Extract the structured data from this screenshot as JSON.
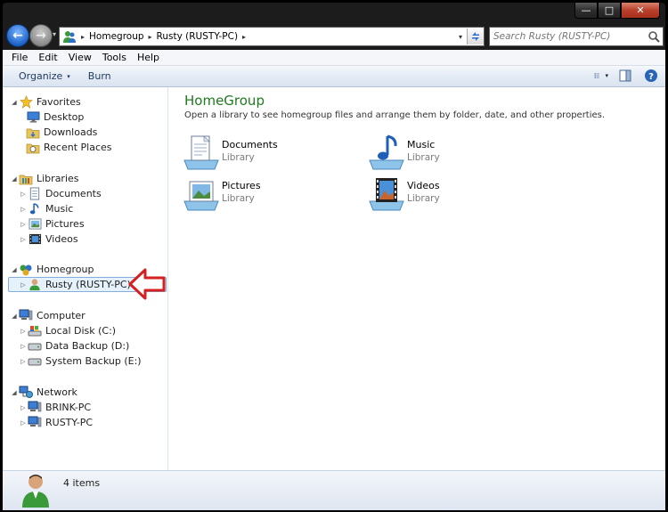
{
  "window": {
    "minimize_glyph": "—",
    "maximize_glyph": "□",
    "close_glyph": "✕"
  },
  "navigation": {
    "back_glyph": "←",
    "forward_glyph": "→",
    "history_dropdown_glyph": "▾"
  },
  "address_bar": {
    "icon": "homegroup-icon",
    "breadcrumb": [
      "Homegroup",
      "Rusty (RUSTY-PC)"
    ],
    "separator_glyph": "▸"
  },
  "search": {
    "placeholder": "Search Rusty (RUSTY-PC)"
  },
  "menubar": {
    "items": [
      "File",
      "Edit",
      "View",
      "Tools",
      "Help"
    ]
  },
  "toolbar": {
    "organize": "Organize",
    "burn": "Burn",
    "dropdown_glyph": "▾"
  },
  "nav_tree": {
    "favorites": {
      "label": "Favorites",
      "children": [
        "Desktop",
        "Downloads",
        "Recent Places"
      ]
    },
    "libraries": {
      "label": "Libraries",
      "children": [
        "Documents",
        "Music",
        "Pictures",
        "Videos"
      ]
    },
    "homegroup": {
      "label": "Homegroup",
      "children": [
        "Rusty (RUSTY-PC)"
      ]
    },
    "computer": {
      "label": "Computer",
      "children": [
        "Local Disk (C:)",
        "Data Backup (D:)",
        "System Backup (E:)"
      ]
    },
    "network": {
      "label": "Network",
      "children": [
        "BRINK-PC",
        "RUSTY-PC"
      ]
    },
    "expanded_glyph": "◢",
    "collapsed_glyph": "▷"
  },
  "content": {
    "title": "HomeGroup",
    "subtitle": "Open a library to see homegroup files and arrange them by folder, date, and other properties.",
    "libraries": [
      {
        "name": "Documents",
        "type": "Library",
        "icon": "documents-library-icon"
      },
      {
        "name": "Music",
        "type": "Library",
        "icon": "music-library-icon"
      },
      {
        "name": "Pictures",
        "type": "Library",
        "icon": "pictures-library-icon"
      },
      {
        "name": "Videos",
        "type": "Library",
        "icon": "videos-library-icon"
      }
    ]
  },
  "status": {
    "count": "4 items"
  },
  "colors": {
    "title_green": "#1e7b1e",
    "selection_bg": "#e5f1fb",
    "annotation_red": "#d42020"
  }
}
